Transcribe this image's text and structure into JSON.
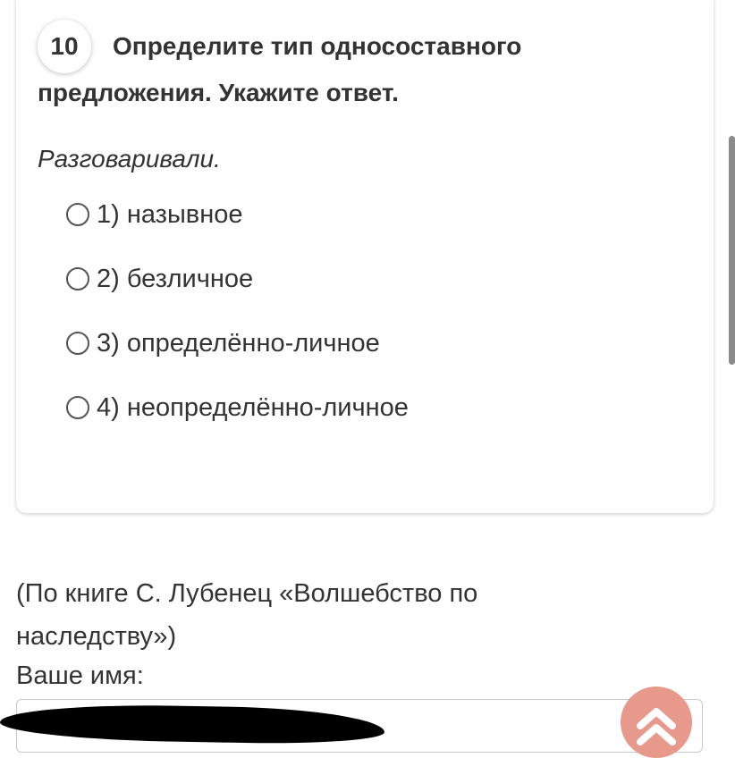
{
  "question": {
    "number": "10",
    "title": "Определите тип односоставного предложения. Укажите ответ.",
    "example": "Разговаривали.",
    "options": [
      {
        "label": "1) назывное"
      },
      {
        "label": "2) безличное"
      },
      {
        "label": "3) определённо-личное"
      },
      {
        "label": "4) неопределённо-личное"
      }
    ]
  },
  "source_text": "(По книге С. Лубенец «Волшебство по наследству»)",
  "name_field": {
    "label": "Ваше имя:",
    "value": ""
  },
  "icons": {
    "scroll_top": "double-chevron-up-icon"
  },
  "colors": {
    "scroll_top_button": "#e79a8c",
    "card_background": "#ffffff"
  }
}
